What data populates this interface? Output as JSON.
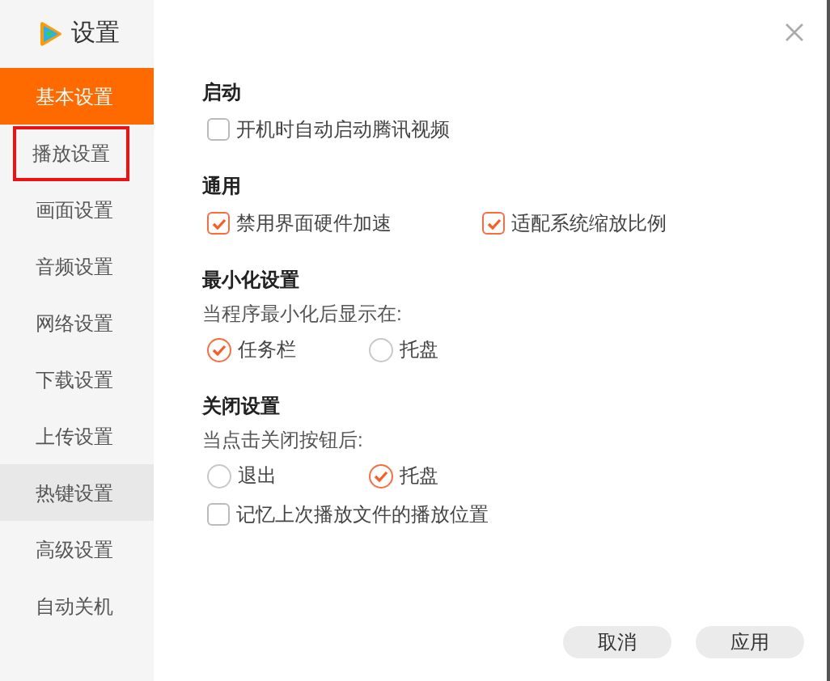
{
  "window": {
    "title": "设置"
  },
  "sidebar": {
    "items": [
      {
        "label": "基本设置",
        "selected": true,
        "hovered": false,
        "outlined": false
      },
      {
        "label": "播放设置",
        "selected": false,
        "hovered": false,
        "outlined": true
      },
      {
        "label": "画面设置",
        "selected": false,
        "hovered": false,
        "outlined": false
      },
      {
        "label": "音频设置",
        "selected": false,
        "hovered": false,
        "outlined": false
      },
      {
        "label": "网络设置",
        "selected": false,
        "hovered": false,
        "outlined": false
      },
      {
        "label": "下载设置",
        "selected": false,
        "hovered": false,
        "outlined": false
      },
      {
        "label": "上传设置",
        "selected": false,
        "hovered": false,
        "outlined": false
      },
      {
        "label": "热键设置",
        "selected": false,
        "hovered": true,
        "outlined": false
      },
      {
        "label": "高级设置",
        "selected": false,
        "hovered": false,
        "outlined": false
      },
      {
        "label": "自动关机",
        "selected": false,
        "hovered": false,
        "outlined": false
      }
    ]
  },
  "sections": [
    {
      "title": "启动",
      "rows": [
        {
          "kind": "checks",
          "options": [
            {
              "label": "开机时自动启动腾讯视频",
              "checked": false
            }
          ]
        }
      ]
    },
    {
      "title": "通用",
      "rows": [
        {
          "kind": "checks",
          "options": [
            {
              "label": "禁用界面硬件加速",
              "checked": true
            },
            {
              "label": "适配系统缩放比例",
              "checked": true
            }
          ]
        }
      ]
    },
    {
      "title": "最小化设置",
      "rows": [
        {
          "kind": "text",
          "text": "当程序最小化后显示在:"
        },
        {
          "kind": "radios",
          "options": [
            {
              "label": "任务栏",
              "selected": true
            },
            {
              "label": "托盘",
              "selected": false
            }
          ]
        }
      ]
    },
    {
      "title": "关闭设置",
      "rows": [
        {
          "kind": "text",
          "text": "当点击关闭按钮后:"
        },
        {
          "kind": "radios",
          "options": [
            {
              "label": "退出",
              "selected": false
            },
            {
              "label": "托盘",
              "selected": true
            }
          ]
        },
        {
          "kind": "checks",
          "options": [
            {
              "label": "记忆上次播放文件的播放位置",
              "checked": false
            }
          ]
        }
      ]
    }
  ],
  "buttons": [
    "取消",
    "应用"
  ]
}
